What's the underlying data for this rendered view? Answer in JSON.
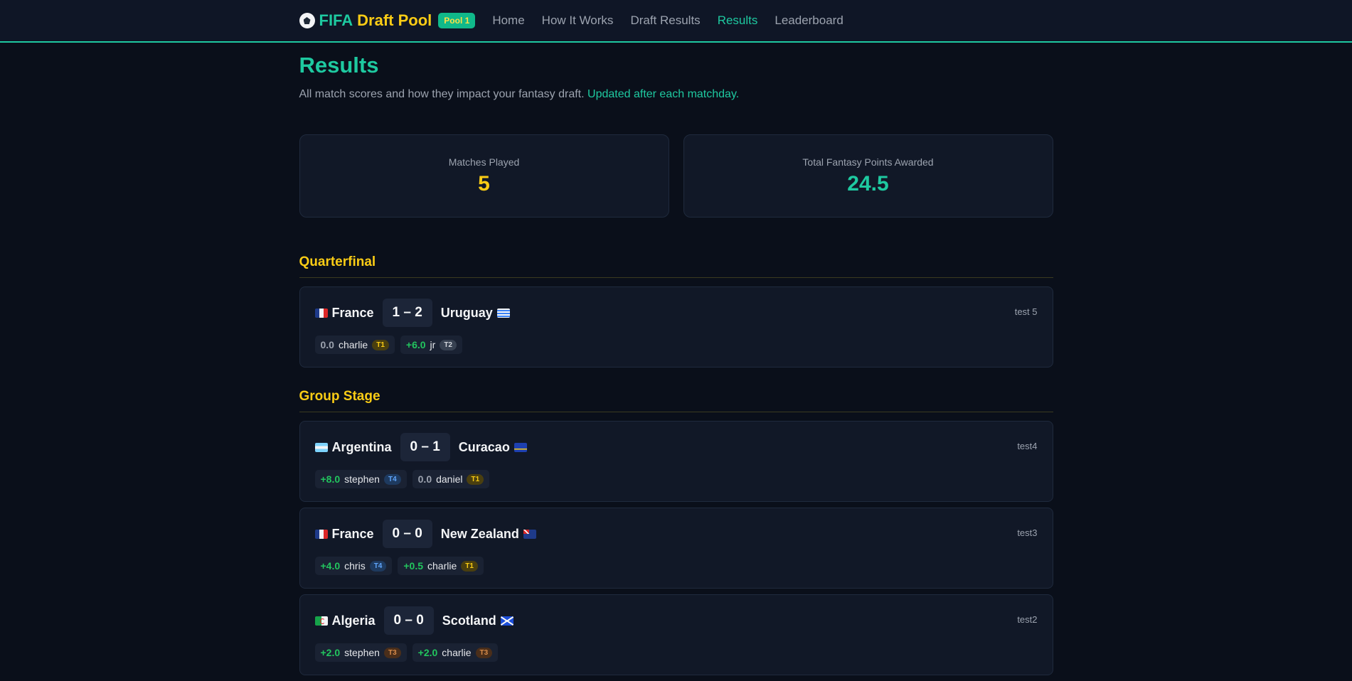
{
  "nav": {
    "brand_part1": "FIFA",
    "brand_part2": "Draft Pool",
    "pool_badge": "Pool 1",
    "links": [
      "Home",
      "How It Works",
      "Draft Results",
      "Results",
      "Leaderboard"
    ],
    "active_link": "Results",
    "brand_icon": "soccer-ball-icon"
  },
  "page": {
    "title": "Results",
    "subtitle": "All match scores and how they impact your fantasy draft.",
    "subtitle_highlight": "Updated after each matchday."
  },
  "stats": {
    "matches_label": "Matches Played",
    "matches_value": "5",
    "points_label": "Total Fantasy Points Awarded",
    "points_value": "24.5"
  },
  "sections": [
    {
      "title": "Quarterfinal",
      "matches": [
        {
          "home": "France",
          "home_flag": "france",
          "score": "1 – 2",
          "away": "Uruguay",
          "away_flag": "uruguay",
          "label": "test 5",
          "picks": [
            {
              "pts": "0.0",
              "name": "charlie",
              "tier": "T1"
            },
            {
              "pts": "+6.0",
              "name": "jr",
              "tier": "T2"
            }
          ]
        }
      ]
    },
    {
      "title": "Group Stage",
      "matches": [
        {
          "home": "Argentina",
          "home_flag": "argentina",
          "score": "0 – 1",
          "away": "Curacao",
          "away_flag": "curacao",
          "label": "test4",
          "picks": [
            {
              "pts": "+8.0",
              "name": "stephen",
              "tier": "T4"
            },
            {
              "pts": "0.0",
              "name": "daniel",
              "tier": "T1"
            }
          ]
        },
        {
          "home": "France",
          "home_flag": "france",
          "score": "0 – 0",
          "away": "New Zealand",
          "away_flag": "nz",
          "label": "test3",
          "picks": [
            {
              "pts": "+4.0",
              "name": "chris",
              "tier": "T4"
            },
            {
              "pts": "+0.5",
              "name": "charlie",
              "tier": "T1"
            }
          ]
        },
        {
          "home": "Algeria",
          "home_flag": "algeria",
          "score": "0 – 0",
          "away": "Scotland",
          "away_flag": "scotland",
          "label": "test2",
          "picks": [
            {
              "pts": "+2.0",
              "name": "stephen",
              "tier": "T3"
            },
            {
              "pts": "+2.0",
              "name": "charlie",
              "tier": "T3"
            }
          ]
        }
      ]
    }
  ]
}
